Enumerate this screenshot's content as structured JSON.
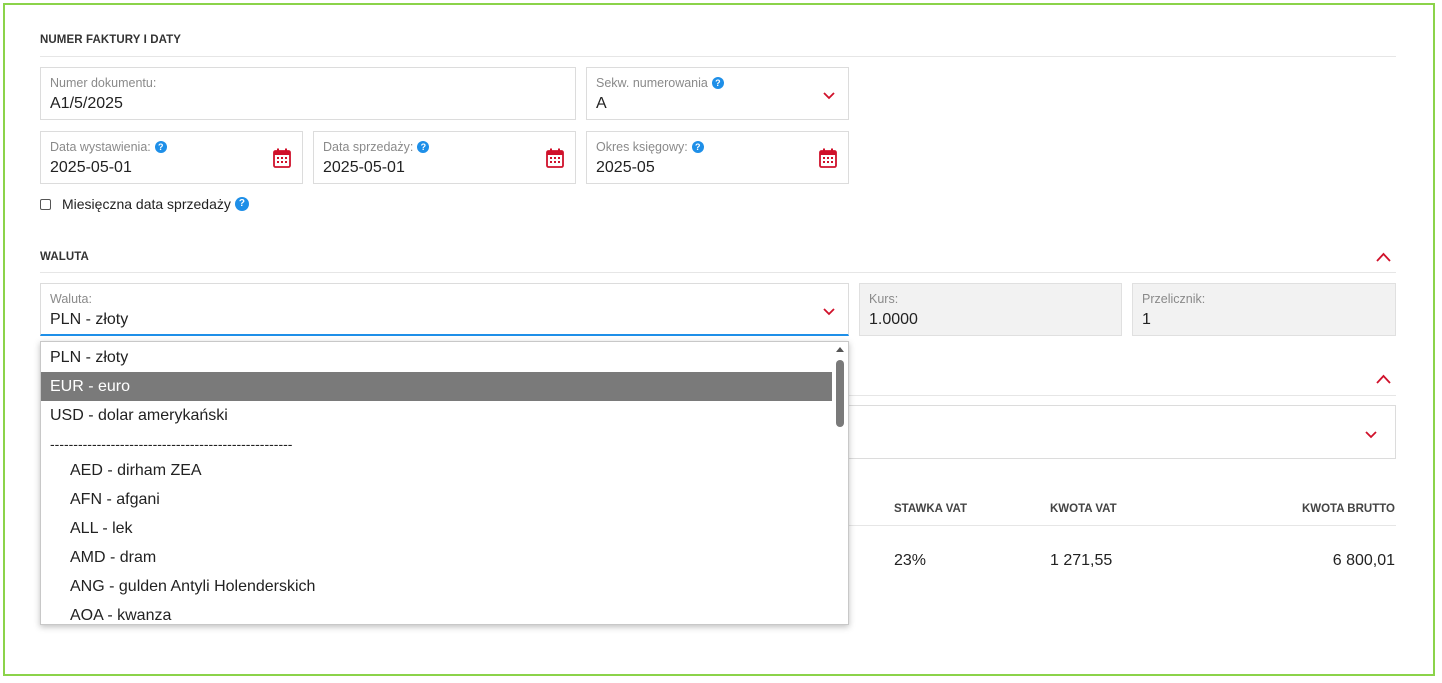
{
  "sections": {
    "invoice_title": "NUMER FAKTURY I DATY",
    "currency_title": "WALUTA"
  },
  "fields": {
    "doc_number": {
      "label": "Numer dokumentu:",
      "value": "A1/5/2025"
    },
    "sequence": {
      "label": "Sekw. numerowania",
      "value": "A"
    },
    "issue_date": {
      "label": "Data wystawienia:",
      "value": "2025-05-01"
    },
    "sale_date": {
      "label": "Data sprzedaży:",
      "value": "2025-05-01"
    },
    "period": {
      "label": "Okres księgowy:",
      "value": "2025-05"
    },
    "monthly_sale_checkbox": {
      "label": "Miesięczna data sprzedaży",
      "checked": false
    },
    "currency": {
      "label": "Waluta:",
      "value": "PLN - złoty"
    },
    "rate": {
      "label": "Kurs:",
      "value": "1.0000"
    },
    "converter": {
      "label": "Przelicznik:",
      "value": "1"
    }
  },
  "help_icon": "?",
  "table": {
    "headers": [
      "STAWKA VAT",
      "KWOTA VAT",
      "KWOTA BRUTTO"
    ],
    "row": [
      "23%",
      "1 271,55",
      "6 800,01"
    ]
  },
  "dropdown": {
    "options": [
      {
        "label": "PLN - złoty",
        "selected": false,
        "child": false
      },
      {
        "label": "EUR - euro",
        "selected": true,
        "child": false
      },
      {
        "label": "USD - dolar amerykański",
        "selected": false,
        "child": false
      },
      {
        "label": "----------------------------------------------------",
        "selected": false,
        "child": false
      },
      {
        "label": "AED - dirham ZEA",
        "selected": false,
        "child": true
      },
      {
        "label": "AFN - afgani",
        "selected": false,
        "child": true
      },
      {
        "label": "ALL - lek",
        "selected": false,
        "child": true
      },
      {
        "label": "AMD - dram",
        "selected": false,
        "child": true
      },
      {
        "label": "ANG - gulden Antyli Holenderskich",
        "selected": false,
        "child": true
      },
      {
        "label": "AOA - kwanza",
        "selected": false,
        "child": true
      }
    ]
  },
  "colors": {
    "accent_red": "#d0112b",
    "help_blue": "#1e8fe8",
    "frame_green": "#8bd34a",
    "selected_gray": "#7a7a7a"
  }
}
